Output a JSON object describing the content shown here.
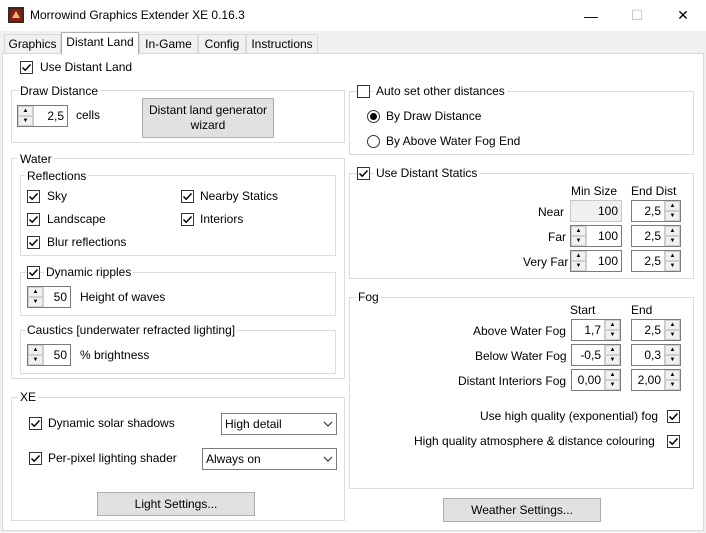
{
  "window": {
    "title": "Morrowind Graphics Extender XE 0.16.3",
    "minimize": "—",
    "maximize": "☐",
    "close": "✕"
  },
  "tabs": [
    "Graphics",
    "Distant Land",
    "In-Game",
    "Config",
    "Instructions"
  ],
  "active_tab": "Distant Land",
  "use_distant_land": {
    "label": "Use Distant Land",
    "checked": true
  },
  "draw_distance": {
    "title": "Draw Distance",
    "value": "2,5",
    "unit": "cells",
    "generator_button_line1": "Distant land generator",
    "generator_button_line2": "wizard"
  },
  "water": {
    "title": "Water",
    "reflections": {
      "title": "Reflections",
      "sky": {
        "label": "Sky",
        "checked": true
      },
      "nearby_statics": {
        "label": "Nearby Statics",
        "checked": true
      },
      "landscape": {
        "label": "Landscape",
        "checked": true
      },
      "interiors": {
        "label": "Interiors",
        "checked": true
      },
      "blur": {
        "label": "Blur reflections",
        "checked": true
      }
    },
    "dynamic_ripples": {
      "label": "Dynamic ripples",
      "checked": true
    },
    "wave_height": {
      "value": "50",
      "label": "Height of waves"
    },
    "caustics": {
      "title": "Caustics [underwater refracted lighting]",
      "value": "50",
      "label": "% brightness"
    }
  },
  "xe": {
    "title": "XE",
    "solar_shadows": {
      "label": "Dynamic solar shadows",
      "checked": true,
      "option": "High detail"
    },
    "per_pixel": {
      "label": "Per-pixel lighting shader",
      "checked": true,
      "option": "Always on"
    },
    "light_settings_button": "Light Settings..."
  },
  "auto_distances": {
    "label": "Auto set other distances",
    "checked": false,
    "by_draw_distance": "By Draw Distance",
    "by_fog_end": "By Above Water Fog End",
    "selected": "By Draw Distance"
  },
  "distant_statics": {
    "label": "Use Distant Statics",
    "checked": true,
    "col_min": "Min Size",
    "col_end": "End Dist",
    "rows": [
      {
        "label": "Near",
        "min": "100",
        "end": "2,5"
      },
      {
        "label": "Far",
        "min": "100",
        "end": "2,5"
      },
      {
        "label": "Very Far",
        "min": "100",
        "end": "2,5"
      }
    ]
  },
  "fog": {
    "title": "Fog",
    "col_start": "Start",
    "col_end": "End",
    "rows": [
      {
        "label": "Above Water Fog",
        "start": "1,7",
        "end": "2,5"
      },
      {
        "label": "Below Water Fog",
        "start": "-0,5",
        "end": "0,3"
      },
      {
        "label": "Distant Interiors Fog",
        "start": "0,00",
        "end": "2,00"
      }
    ],
    "hq_fog": {
      "label": "Use high quality (exponential) fog",
      "checked": true
    },
    "hq_atmosphere": {
      "label": "High quality atmosphere & distance colouring",
      "checked": true
    }
  },
  "weather_settings_button": "Weather Settings...",
  "icons": {
    "app": "app-icon",
    "check": "check-icon",
    "spin_up": "arrow-up-icon",
    "spin_down": "arrow-down-icon",
    "dropdown": "chevron-down-icon"
  },
  "colors": {
    "window_bg": "#f0f0f0",
    "panel_bg": "#ffffff",
    "button_bg": "#e1e1e1",
    "border": "#dcdcdc"
  }
}
